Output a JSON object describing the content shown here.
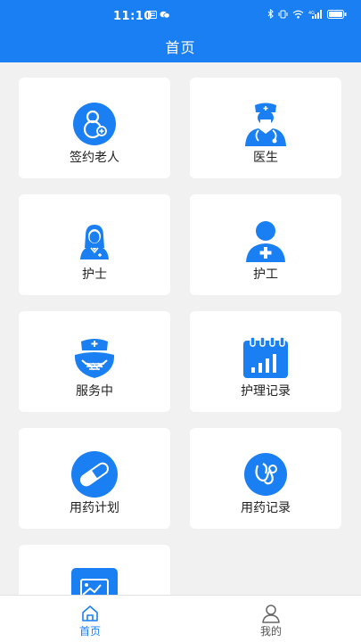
{
  "status_bar": {
    "time": "11:10"
  },
  "header": {
    "title": "首页"
  },
  "colors": {
    "primary": "#1a7ff2",
    "background": "#f1f1f1"
  },
  "menu": [
    {
      "label": "签约老人",
      "icon": "elder-icon"
    },
    {
      "label": "医生",
      "icon": "doctor-icon"
    },
    {
      "label": "护士",
      "icon": "nurse-icon"
    },
    {
      "label": "护工",
      "icon": "caregiver-icon"
    },
    {
      "label": "服务中",
      "icon": "nurse-cap-icon"
    },
    {
      "label": "护理记录",
      "icon": "calendar-chart-icon"
    },
    {
      "label": "用药计划",
      "icon": "pill-icon"
    },
    {
      "label": "用药记录",
      "icon": "stethoscope-icon"
    },
    {
      "label": "",
      "icon": "report-icon"
    }
  ],
  "tabbar": [
    {
      "label": "首页",
      "icon": "home-icon",
      "active": true
    },
    {
      "label": "我的",
      "icon": "user-icon",
      "active": false
    }
  ]
}
